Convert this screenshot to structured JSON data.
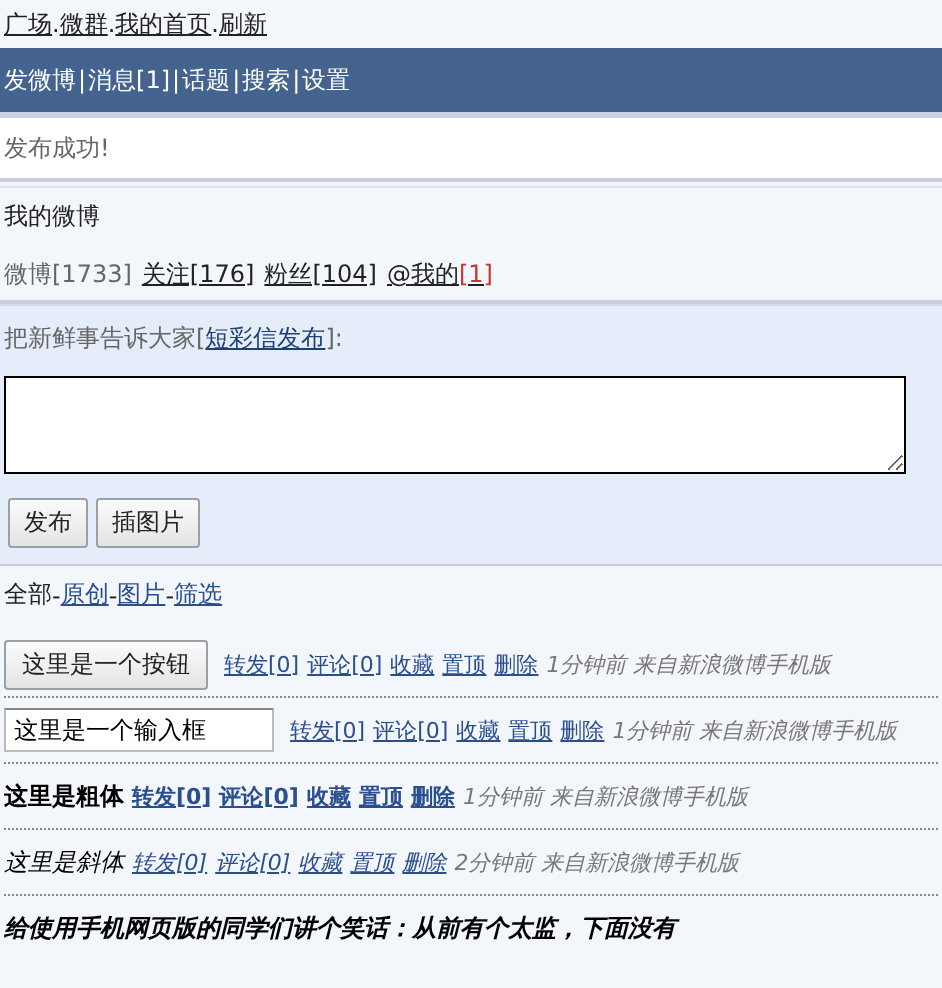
{
  "top_links": [
    "广场",
    "微群",
    "我的首页",
    "刷新"
  ],
  "top_separator": ".",
  "nav_separator": "|",
  "filter_separator": "-",
  "nav": [
    {
      "label": "发微博"
    },
    {
      "label": "消息[1]"
    },
    {
      "label": "话题"
    },
    {
      "label": "搜索"
    },
    {
      "label": "设置"
    }
  ],
  "notice": "发布成功!",
  "profile": {
    "title": "我的微博",
    "weibo": "微博[1733]",
    "links": [
      "关注[176]",
      "粉丝[104]"
    ],
    "at_label": "@我的",
    "at_count": "[1]"
  },
  "compose": {
    "prompt": "把新鲜事告诉大家[",
    "prompt_link": "短彩信发布",
    "prompt_end": "]:",
    "buttons": [
      "发布",
      "插图片"
    ]
  },
  "filter": {
    "current": "全部",
    "links": [
      "原创",
      "图片",
      "筛选"
    ]
  },
  "posts": [
    {
      "kind": "button",
      "content": "这里是一个按钮",
      "actions": [
        "转发[0]",
        "评论[0]",
        "收藏",
        "置顶",
        "删除"
      ],
      "meta": "1分钟前 来自新浪微博手机版"
    },
    {
      "kind": "input",
      "content": "这里是一个输入框",
      "actions": [
        "转发[0]",
        "评论[0]",
        "收藏",
        "置顶",
        "删除"
      ],
      "meta": "1分钟前 来自新浪微博手机版"
    },
    {
      "kind": "bold",
      "content": "这里是粗体",
      "actions": [
        "转发[0]",
        "评论[0]",
        "收藏",
        "置顶",
        "删除"
      ],
      "meta": "1分钟前 来自新浪微博手机版"
    },
    {
      "kind": "italic",
      "content": "这里是斜体",
      "actions": [
        "转发[0]",
        "评论[0]",
        "收藏",
        "置顶",
        "删除"
      ],
      "meta": "2分钟前 来自新浪微博手机版"
    },
    {
      "kind": "joke",
      "content": "给使用手机网页版的同学们讲个笑话：从前有个太监，下面没有"
    }
  ]
}
